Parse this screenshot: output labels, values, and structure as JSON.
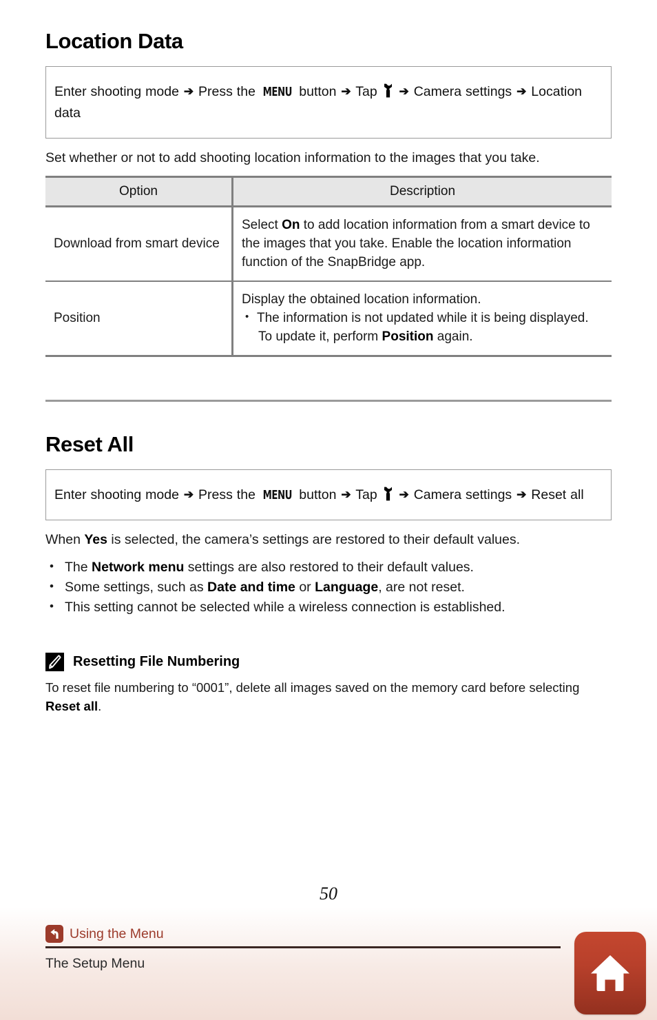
{
  "sections": [
    {
      "title": "Location Data",
      "path": {
        "prefix": "Enter shooting mode",
        "step1": "Press the",
        "menu_glyph": "MENU",
        "step1_suffix": "button",
        "step2": "Tap",
        "wrench_icon": "wrench-icon",
        "step3": "Camera settings",
        "step4": "Location data",
        "arrow": "➔"
      },
      "intro": "Set whether or not to add shooting location information to the images that you take.",
      "table": {
        "headers": [
          "Option",
          "Description"
        ],
        "rows": [
          {
            "option": "Download from smart device",
            "desc_lead_a": "Select ",
            "desc_lead_bold": "On",
            "desc_lead_b": " to add location information from a smart device to the images that you take. Enable the location information function of the SnapBridge app."
          },
          {
            "option": "Position",
            "desc_intro": "Display the obtained location information.",
            "bullet_a": "The information is not updated while it is being displayed.",
            "bullet_b_pre": "To update it, perform ",
            "bullet_b_bold": "Position",
            "bullet_b_post": " again."
          }
        ]
      }
    },
    {
      "title": "Reset All",
      "path": {
        "prefix": "Enter shooting mode",
        "step1": "Press the",
        "menu_glyph": "MENU",
        "step1_suffix": "button",
        "step2": "Tap",
        "wrench_icon": "wrench-icon",
        "step3": "Camera settings",
        "step4": "Reset all",
        "arrow": "➔"
      },
      "lead_a": "When ",
      "lead_bold": "Yes",
      "lead_b": " is selected, the camera’s settings are restored to their default values.",
      "bullets": [
        {
          "pre": "The ",
          "bold": "Network menu",
          "post": " settings are also restored to their default values."
        },
        {
          "pre": "Some settings, such as ",
          "bold": "Date and time",
          "mid": " or ",
          "bold2": "Language",
          "post": ", are not reset."
        },
        {
          "pre": "This setting cannot be selected while a wireless connection is established.",
          "bold": "",
          "post": ""
        }
      ]
    }
  ],
  "note": {
    "icon": "pencil-icon",
    "title": "Resetting File Numbering",
    "body_a": "To reset file numbering to “0001”, delete all images saved on the memory card before selecting ",
    "body_bold": "Reset all",
    "body_b": "."
  },
  "footer": {
    "page_number": "50",
    "back_icon": "back-arrow-icon",
    "link_label": "Using the Menu",
    "subtitle": "The Setup Menu",
    "home_icon": "home-icon"
  },
  "colors": {
    "accent_red": "#9c3b2b",
    "home_button": "#b8402b",
    "table_header_bg": "#e6e6e6",
    "rule_gray": "#808080"
  }
}
